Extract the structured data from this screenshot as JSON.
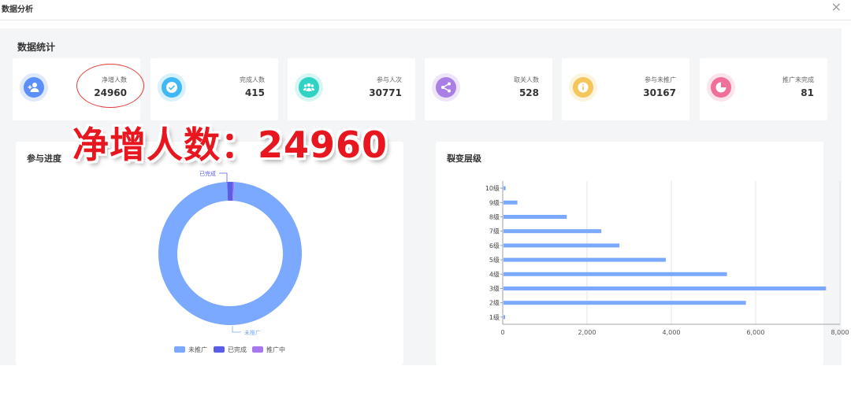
{
  "window": {
    "title": "数据分析",
    "close_glyph": "×"
  },
  "section_title": "数据统计",
  "stats": [
    {
      "label": "净增人数",
      "value": "24960",
      "icon": "add-user-icon",
      "color": "#5b8ff9"
    },
    {
      "label": "完成人数",
      "value": "415",
      "icon": "check-icon",
      "color": "#40b8f5"
    },
    {
      "label": "参与人次",
      "value": "30771",
      "icon": "group-icon",
      "color": "#2fd3c4"
    },
    {
      "label": "取关人数",
      "value": "528",
      "icon": "share-icon",
      "color": "#a97fe6"
    },
    {
      "label": "参与未推广",
      "value": "30167",
      "icon": "info-icon",
      "color": "#f4c65c"
    },
    {
      "label": "推广未完成",
      "value": "81",
      "icon": "pie-icon",
      "color": "#ef6f98"
    }
  ],
  "overlay_caption": "净增人数：24960",
  "panels": {
    "progress_title": "参与进度",
    "levels_title": "裂变层级"
  },
  "chart_data": [
    {
      "type": "pie",
      "donut": true,
      "slices": [
        {
          "name": "未推广",
          "value": 30167,
          "color": "#7aa9ff"
        },
        {
          "name": "已完成",
          "value": 415,
          "color": "#5b5de8"
        },
        {
          "name": "推广中",
          "value": 81,
          "color": "#a777f0"
        }
      ],
      "labels_shown": [
        "已完成",
        "未推广"
      ],
      "legend": [
        "未推广",
        "已完成",
        "推广中"
      ],
      "legend_placement": "bottom"
    },
    {
      "type": "bar",
      "orientation": "horizontal",
      "categories": [
        "1级",
        "2级",
        "3级",
        "4级",
        "5级",
        "6级",
        "7级",
        "8级",
        "9级",
        "10级"
      ],
      "values": [
        15,
        5750,
        7650,
        5300,
        3850,
        2750,
        2320,
        1500,
        330,
        50
      ],
      "xlim": [
        0,
        8000
      ],
      "xticks": [
        "0",
        "2,000",
        "4,000",
        "6,000",
        "8,000"
      ],
      "grid": true,
      "color": "#7aa9ff"
    }
  ]
}
